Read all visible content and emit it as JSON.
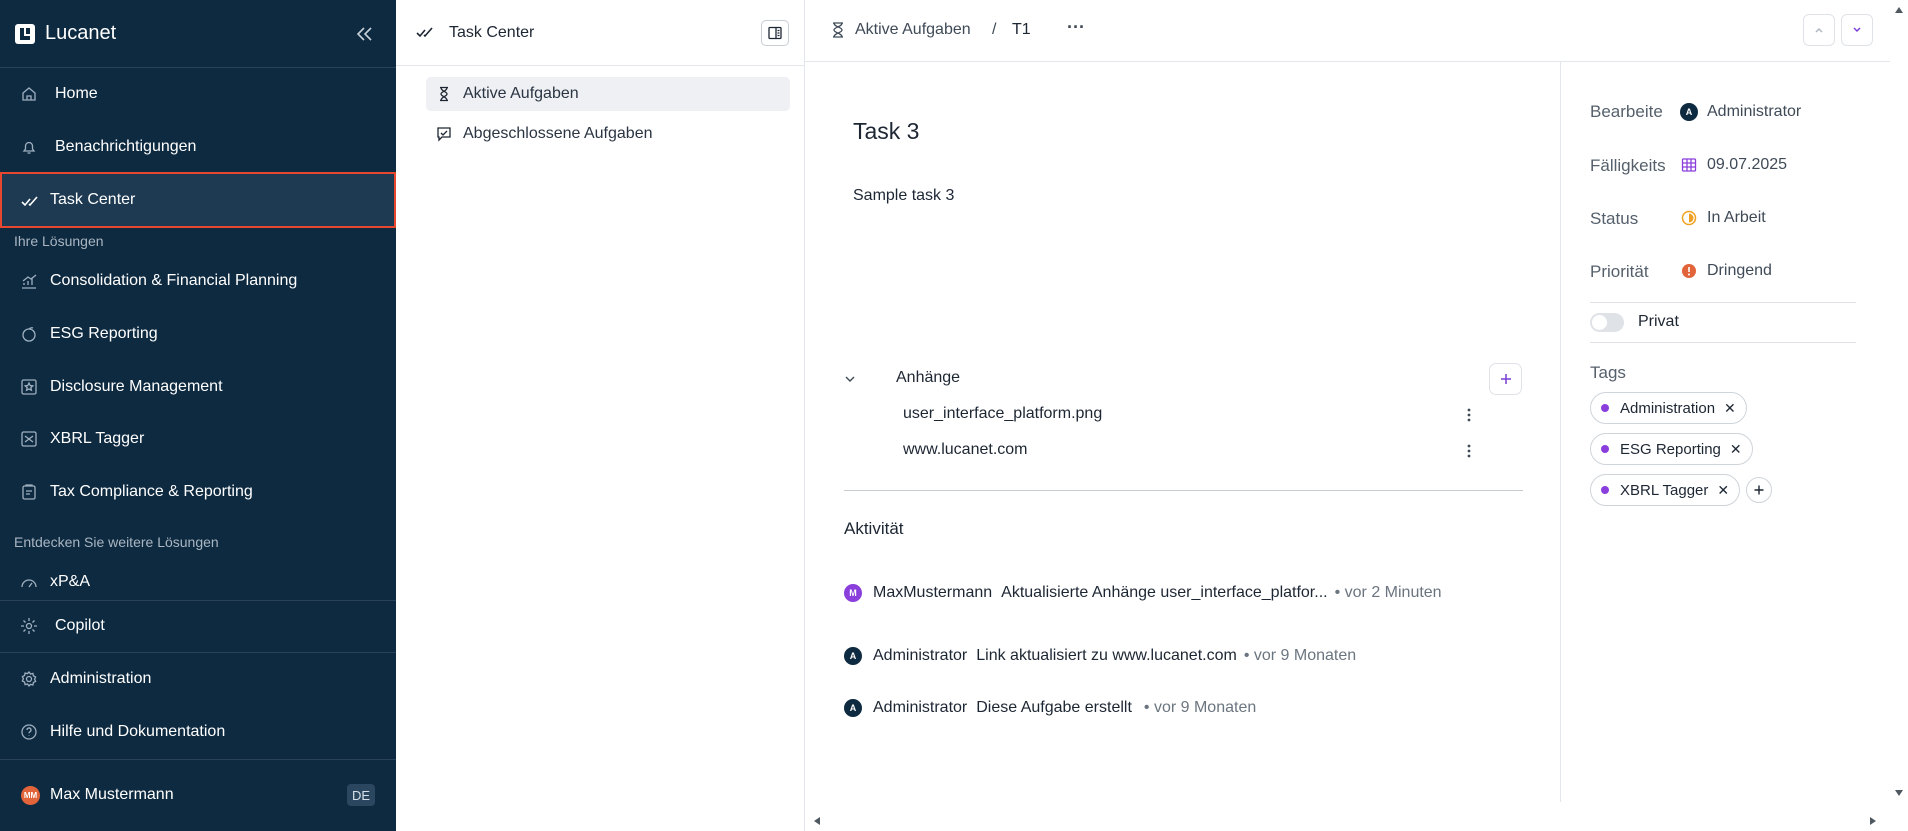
{
  "sidebar": {
    "brand": "Lucanet",
    "items": [
      {
        "label": "Home"
      },
      {
        "label": "Benachrichtigungen"
      },
      {
        "label": "Task Center"
      }
    ],
    "section_solutions": "Ihre Lösungen",
    "solutions": [
      {
        "label": "Consolidation & Financial Planning"
      },
      {
        "label": "ESG Reporting"
      },
      {
        "label": "Disclosure Management"
      },
      {
        "label": "XBRL Tagger"
      },
      {
        "label": "Tax Compliance & Reporting"
      }
    ],
    "section_discover": "Entdecken Sie weitere Lösungen",
    "discover": [
      {
        "label": "xP&A"
      }
    ],
    "bottom": [
      {
        "label": "Copilot"
      },
      {
        "label": "Administration"
      },
      {
        "label": "Hilfe und Dokumentation"
      }
    ],
    "user": {
      "initials": "MM",
      "name": "Max Mustermann",
      "lang": "DE"
    },
    "accent": "#e8472f"
  },
  "middle": {
    "title": "Task Center",
    "nav": [
      {
        "label": "Aktive Aufgaben",
        "selected": true
      },
      {
        "label": "Abgeschlossene Aufgaben",
        "selected": false
      }
    ]
  },
  "breadcrumb": {
    "parent": "Aktive Aufgaben",
    "sep": "/",
    "current": "T1",
    "more": "···"
  },
  "task": {
    "title": "Task 3",
    "description": "Sample task 3"
  },
  "attachments": {
    "heading": "Anhänge",
    "items": [
      {
        "name": "user_interface_platform.png"
      },
      {
        "name": "www.lucanet.com"
      }
    ]
  },
  "activity": {
    "heading": "Aktivität",
    "items": [
      {
        "initial": "M",
        "color": "#8a3fdc",
        "user": "MaxMustermann",
        "text": "Aktualisierte Anhänge user_interface_platfor...",
        "time": "• vor 2 Minuten"
      },
      {
        "initial": "A",
        "color": "#0e2a40",
        "user": "Administrator",
        "text": "Link aktualisiert zu www.lucanet.com",
        "time": "• vor 9 Monaten"
      },
      {
        "initial": "A",
        "color": "#0e2a40",
        "user": "Administrator",
        "text": "Diese Aufgabe erstellt",
        "time": "• vor 9 Monaten"
      }
    ]
  },
  "properties": {
    "assignee": {
      "label": "Bearbeite",
      "initial": "A",
      "value": "Administrator"
    },
    "due": {
      "label": "Fälligkeits",
      "value": "09.07.2025"
    },
    "status": {
      "label": "Status",
      "value": "In Arbeit",
      "color": "#f0a020"
    },
    "priority": {
      "label": "Priorität",
      "value": "Dringend",
      "color": "#e2643a"
    },
    "private": {
      "label": "Privat",
      "on": false
    },
    "tags_label": "Tags",
    "tags": [
      {
        "label": "Administration"
      },
      {
        "label": "ESG Reporting"
      },
      {
        "label": "XBRL Tagger"
      }
    ]
  }
}
